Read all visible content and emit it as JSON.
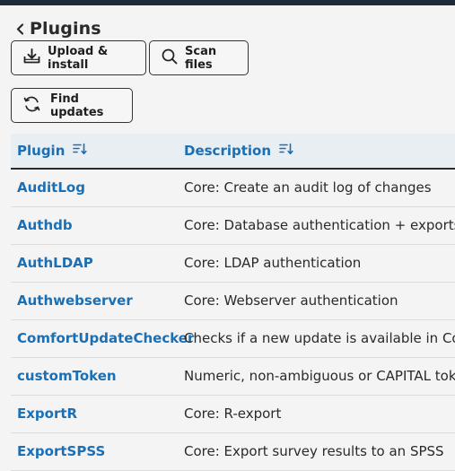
{
  "page": {
    "title": "Plugins",
    "colors": {
      "accent": "#1a6fb5",
      "header_bg": "#e9eef2",
      "topbar": "#1e2a3a"
    }
  },
  "toolbar": {
    "upload_label": "Upload & install",
    "scan_label": "Scan files",
    "updates_label": "Find updates",
    "upload_icon": "download-tray-icon",
    "scan_icon": "search-icon",
    "updates_icon": "refresh-icon"
  },
  "table": {
    "columns": [
      {
        "label": "Plugin",
        "sort_icon": "sort-icon"
      },
      {
        "label": "Description",
        "sort_icon": "sort-icon"
      }
    ],
    "rows": [
      {
        "name": "AuditLog",
        "description": "Core: Create an audit log of changes"
      },
      {
        "name": "Authdb",
        "description": "Core: Database authentication + exports"
      },
      {
        "name": "AuthLDAP",
        "description": "Core: LDAP authentication"
      },
      {
        "name": "Authwebserver",
        "description": "Core: Webserver authentication"
      },
      {
        "name": "ComfortUpdateChecker",
        "description": "Checks if a new update is available in ComfortUpdate"
      },
      {
        "name": "customToken",
        "description": "Numeric, non-ambiguous or CAPITAL tokens"
      },
      {
        "name": "ExportR",
        "description": "Core: R-export"
      },
      {
        "name": "ExportSPSS",
        "description": "Core: Export survey results to an SPSS"
      }
    ]
  }
}
